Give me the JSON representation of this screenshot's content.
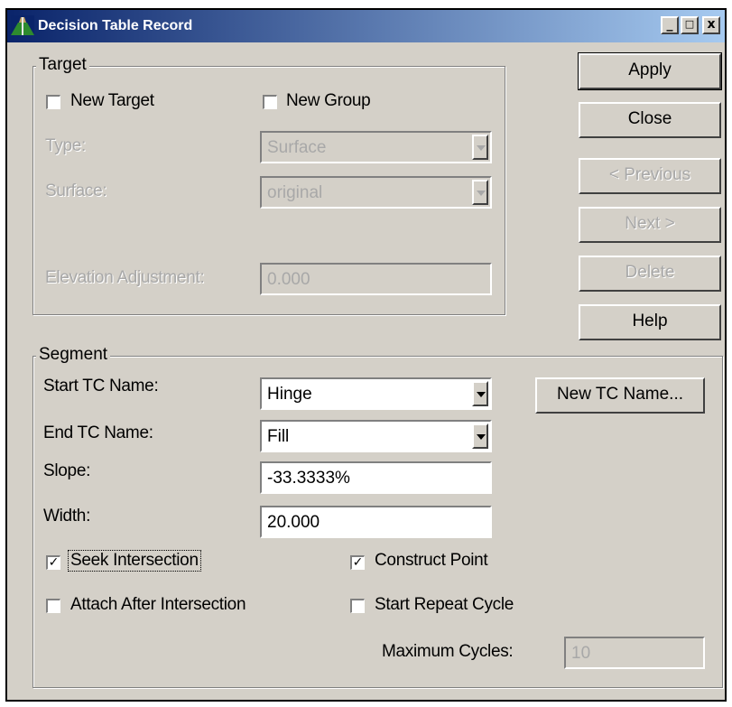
{
  "window": {
    "title": "Decision Table Record",
    "minimize": "_",
    "maximize": "□",
    "close": "x"
  },
  "target": {
    "legend": "Target",
    "new_target_label": "New Target",
    "new_group_label": "New Group",
    "type_label": "Type:",
    "type_value": "Surface",
    "surface_label": "Surface:",
    "surface_value": "original",
    "elevation_label": "Elevation Adjustment:",
    "elevation_value": "0.000"
  },
  "buttons": {
    "apply": "Apply",
    "close": "Close",
    "previous": "< Previous",
    "next": "Next >",
    "delete": "Delete",
    "help": "Help",
    "new_tc_name": "New TC Name..."
  },
  "segment": {
    "legend": "Segment",
    "start_tc_label": "Start TC Name:",
    "start_tc_value": "Hinge",
    "end_tc_label": "End TC Name:",
    "end_tc_value": "Fill",
    "slope_label": "Slope:",
    "slope_value": "-33.3333%",
    "width_label": "Width:",
    "width_value": "20.000",
    "seek_intersection_label": "Seek Intersection",
    "construct_point_label": "Construct Point",
    "attach_after_label": "Attach After Intersection",
    "start_repeat_label": "Start Repeat Cycle",
    "max_cycles_label": "Maximum Cycles:",
    "max_cycles_value": "10",
    "check_mark": "✓"
  }
}
